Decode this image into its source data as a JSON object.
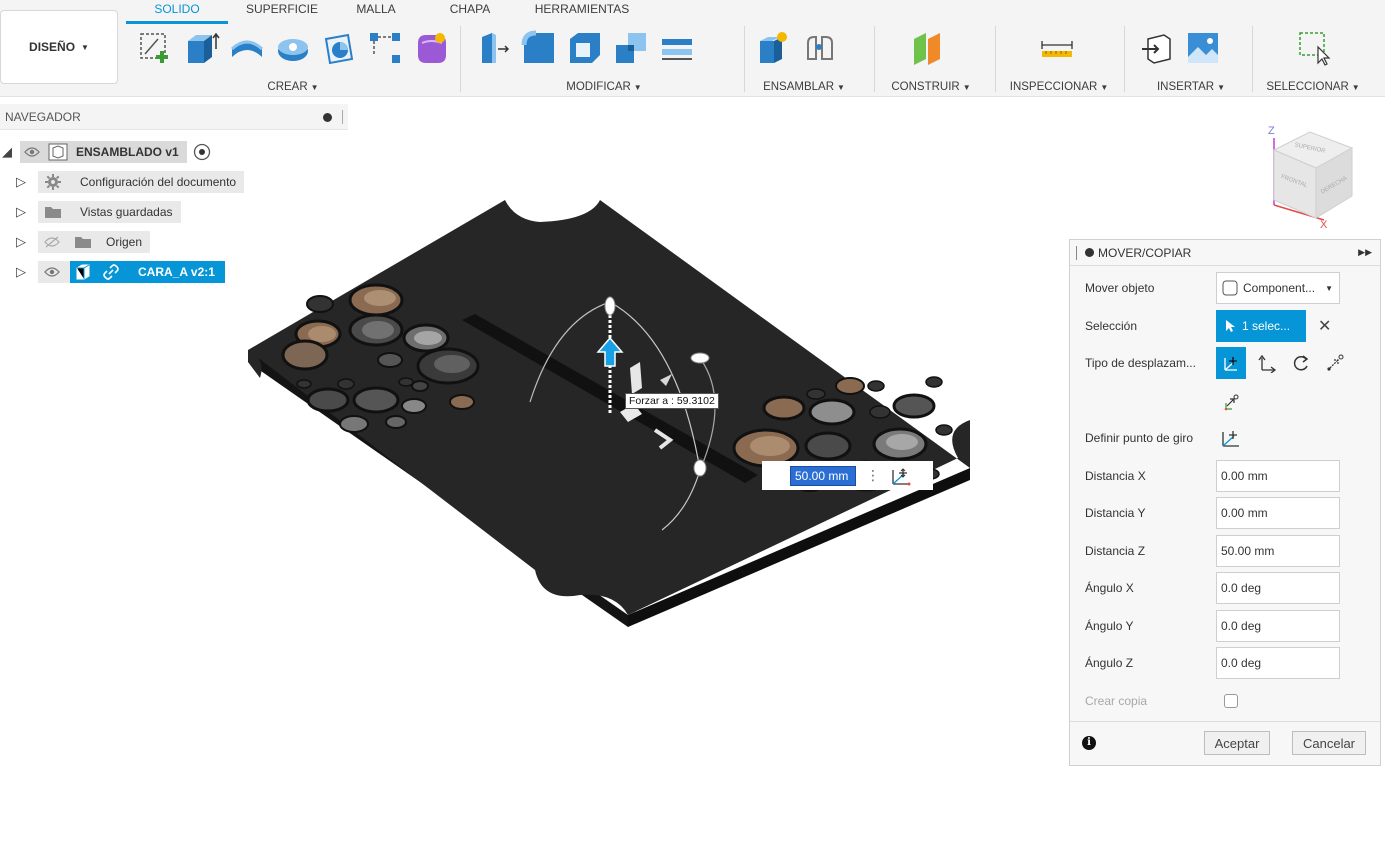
{
  "toolbar": {
    "design_label": "DISEÑO",
    "tabs": [
      "SOLIDO",
      "SUPERFICIE",
      "MALLA",
      "CHAPA",
      "HERRAMIENTAS"
    ],
    "active_tab": "SOLIDO",
    "groups": {
      "crear": "CREAR",
      "modificar": "MODIFICAR",
      "ensamblar": "ENSAMBLAR",
      "construir": "CONSTRUIR",
      "inspeccionar": "INSPECCIONAR",
      "insertar": "INSERTAR",
      "seleccionar": "SELECCIONAR"
    }
  },
  "browser": {
    "title": "NAVEGADOR",
    "items": [
      {
        "label": "ENSAMBLADO v1",
        "icon": "component-icon"
      },
      {
        "label": "Configuración del documento",
        "icon": "gear-icon"
      },
      {
        "label": "Vistas guardadas",
        "icon": "folder-icon"
      },
      {
        "label": "Origen",
        "icon": "folder-icon"
      },
      {
        "label": "CARA_A v2:1",
        "icon": "link-icon"
      }
    ]
  },
  "viewport": {
    "tooltip": "Forzar a : 59.3102",
    "value_input": "50.00 mm"
  },
  "viewcube": {
    "faces": [
      "SUPERIOR",
      "FRONTAL",
      "DERECHA"
    ],
    "axis_z": "Z",
    "axis_x": "X"
  },
  "dialog": {
    "title": "MOVER/COPIAR",
    "move_object_label": "Mover objeto",
    "move_object_value": "Component...",
    "selection_label": "Selección",
    "selection_value": "1 selec...",
    "move_type_label": "Tipo de desplazam...",
    "pivot_label": "Definir punto de giro",
    "distance_x_label": "Distancia X",
    "distance_x": "0.00 mm",
    "distance_y_label": "Distancia Y",
    "distance_y": "0.00 mm",
    "distance_z_label": "Distancia Z",
    "distance_z": "50.00 mm",
    "angle_x_label": "Ángulo X",
    "angle_x": "0.0 deg",
    "angle_y_label": "Ángulo Y",
    "angle_y": "0.0 deg",
    "angle_z_label": "Ángulo Z",
    "angle_z": "0.0 deg",
    "create_copy_label": "Crear copia",
    "accept_label": "Aceptar",
    "cancel_label": "Cancelar"
  },
  "colors": {
    "accent": "#0696d7",
    "plate": "#262626",
    "selected_input": "#2b6fd4"
  }
}
